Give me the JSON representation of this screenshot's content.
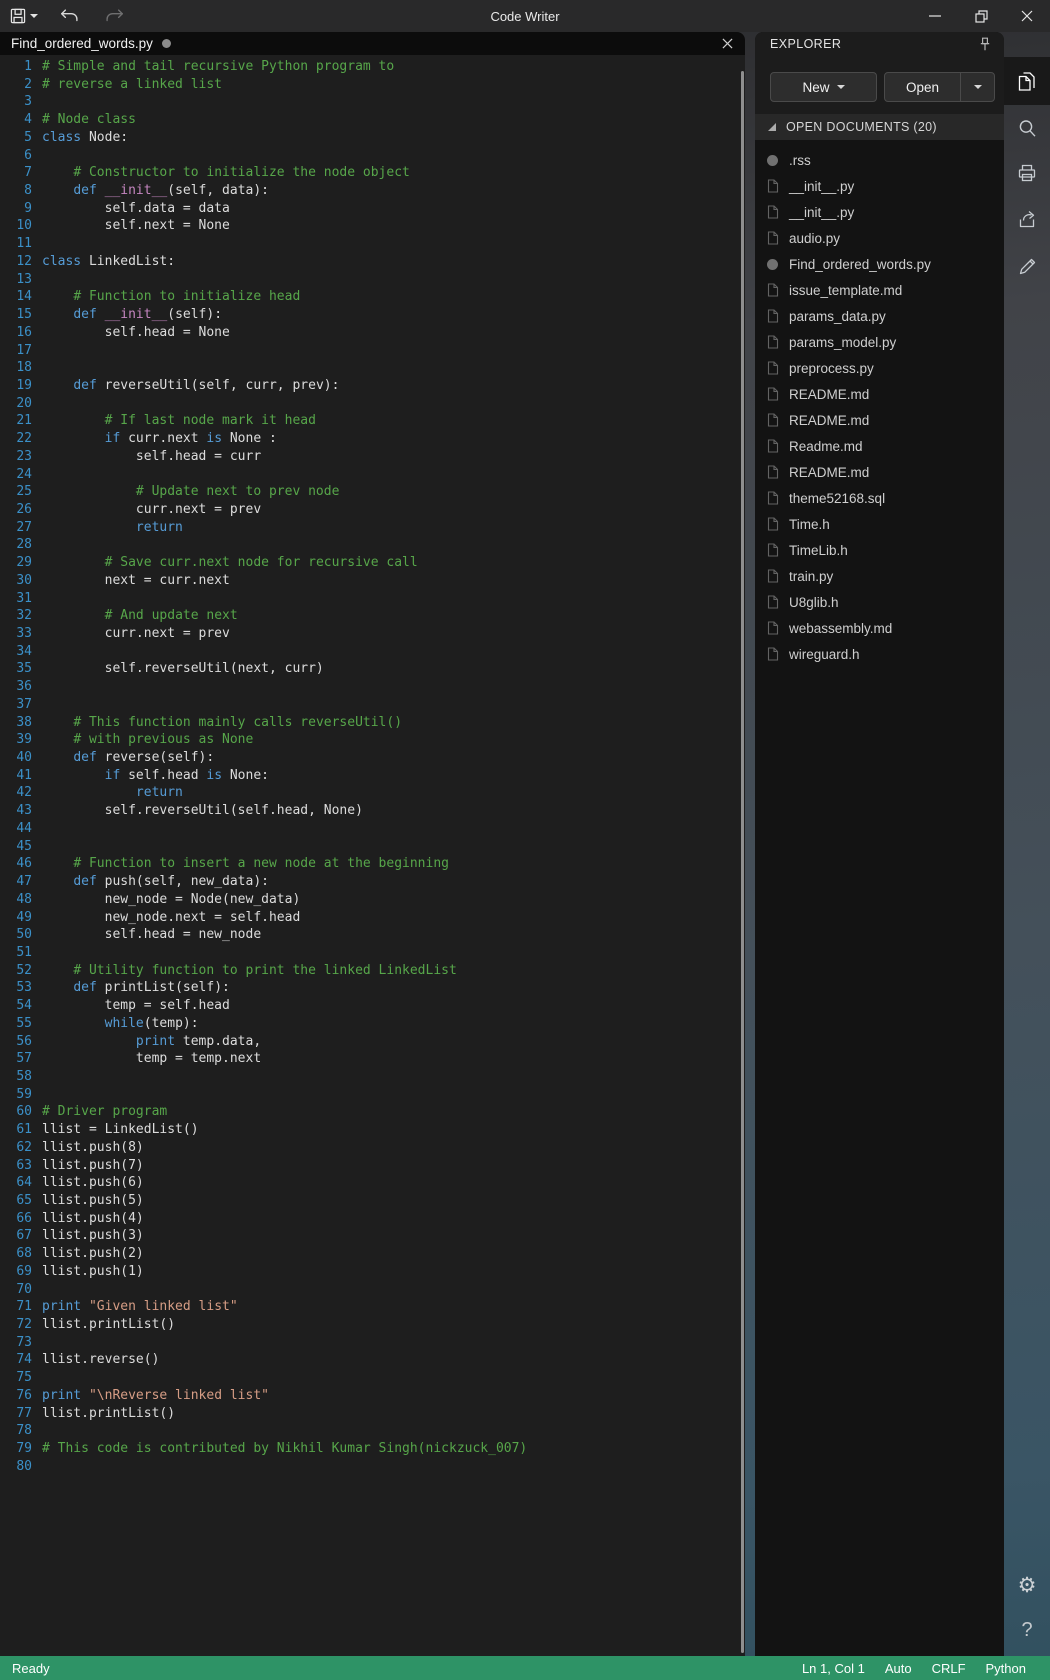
{
  "titlebar": {
    "title": "Code Writer"
  },
  "tab": {
    "label": "Find_ordered_words.py"
  },
  "explorer": {
    "title": "EXPLORER",
    "new_button": "New",
    "open_button": "Open",
    "section": "OPEN DOCUMENTS (20)",
    "files": [
      {
        "name": ".rss",
        "modified": true
      },
      {
        "name": "__init__.py",
        "modified": false
      },
      {
        "name": "__init__.py",
        "modified": false
      },
      {
        "name": "audio.py",
        "modified": false
      },
      {
        "name": "Find_ordered_words.py",
        "modified": true
      },
      {
        "name": "issue_template.md",
        "modified": false
      },
      {
        "name": "params_data.py",
        "modified": false
      },
      {
        "name": "params_model.py",
        "modified": false
      },
      {
        "name": "preprocess.py",
        "modified": false
      },
      {
        "name": "README.md",
        "modified": false
      },
      {
        "name": "README.md",
        "modified": false
      },
      {
        "name": "Readme.md",
        "modified": false
      },
      {
        "name": "README.md",
        "modified": false
      },
      {
        "name": "theme52168.sql",
        "modified": false
      },
      {
        "name": "Time.h",
        "modified": false
      },
      {
        "name": "TimeLib.h",
        "modified": false
      },
      {
        "name": "train.py",
        "modified": false
      },
      {
        "name": "U8glib.h",
        "modified": false
      },
      {
        "name": "webassembly.md",
        "modified": false
      },
      {
        "name": "wireguard.h",
        "modified": false
      }
    ]
  },
  "statusbar": {
    "ready": "Ready",
    "position": "Ln 1, Col 1",
    "encoding": "Auto",
    "eol": "CRLF",
    "language": "Python"
  },
  "colors": {
    "keyword": "#569CD6",
    "comment": "#57A64A",
    "string": "#D69D85",
    "special": "#C586C0",
    "text": "#DCDCDC",
    "line_number": "#3B90C8",
    "status_bar": "#2E9366"
  },
  "code": {
    "language": "Python",
    "lines": [
      [
        [
          "c",
          "# Simple and tail recursive Python program to"
        ]
      ],
      [
        [
          "c",
          "# reverse a linked list"
        ]
      ],
      [],
      [
        [
          "c",
          "# Node class"
        ]
      ],
      [
        [
          "k",
          "class"
        ],
        [
          "t",
          " Node:"
        ]
      ],
      [],
      [
        [
          "t",
          "    "
        ],
        [
          "c",
          "# Constructor to initialize the node object"
        ]
      ],
      [
        [
          "t",
          "    "
        ],
        [
          "k",
          "def"
        ],
        [
          "t",
          " "
        ],
        [
          "m",
          "__init__"
        ],
        [
          "t",
          "(self, data):"
        ]
      ],
      [
        [
          "t",
          "        self.data = data"
        ]
      ],
      [
        [
          "t",
          "        self.next = None"
        ]
      ],
      [],
      [
        [
          "k",
          "class"
        ],
        [
          "t",
          " LinkedList:"
        ]
      ],
      [],
      [
        [
          "t",
          "    "
        ],
        [
          "c",
          "# Function to initialize head"
        ]
      ],
      [
        [
          "t",
          "    "
        ],
        [
          "k",
          "def"
        ],
        [
          "t",
          " "
        ],
        [
          "m",
          "__init__"
        ],
        [
          "t",
          "(self):"
        ]
      ],
      [
        [
          "t",
          "        self.head = None"
        ]
      ],
      [],
      [],
      [
        [
          "t",
          "    "
        ],
        [
          "k",
          "def"
        ],
        [
          "t",
          " reverseUtil(self, curr, prev):"
        ]
      ],
      [],
      [
        [
          "t",
          "        "
        ],
        [
          "c",
          "# If last node mark it head"
        ]
      ],
      [
        [
          "t",
          "        "
        ],
        [
          "k",
          "if"
        ],
        [
          "t",
          " curr.next "
        ],
        [
          "k",
          "is"
        ],
        [
          "t",
          " None :"
        ]
      ],
      [
        [
          "t",
          "            self.head = curr"
        ]
      ],
      [],
      [
        [
          "t",
          "            "
        ],
        [
          "c",
          "# Update next to prev node"
        ]
      ],
      [
        [
          "t",
          "            curr.next = prev"
        ]
      ],
      [
        [
          "t",
          "            "
        ],
        [
          "k",
          "return"
        ]
      ],
      [],
      [
        [
          "t",
          "        "
        ],
        [
          "c",
          "# Save curr.next node for recursive call"
        ]
      ],
      [
        [
          "t",
          "        next = curr.next"
        ]
      ],
      [],
      [
        [
          "t",
          "        "
        ],
        [
          "c",
          "# And update next"
        ]
      ],
      [
        [
          "t",
          "        curr.next = prev"
        ]
      ],
      [],
      [
        [
          "t",
          "        self.reverseUtil(next, curr)"
        ]
      ],
      [],
      [],
      [
        [
          "t",
          "    "
        ],
        [
          "c",
          "# This function mainly calls reverseUtil()"
        ]
      ],
      [
        [
          "t",
          "    "
        ],
        [
          "c",
          "# with previous as None"
        ]
      ],
      [
        [
          "t",
          "    "
        ],
        [
          "k",
          "def"
        ],
        [
          "t",
          " reverse(self):"
        ]
      ],
      [
        [
          "t",
          "        "
        ],
        [
          "k",
          "if"
        ],
        [
          "t",
          " self.head "
        ],
        [
          "k",
          "is"
        ],
        [
          "t",
          " None:"
        ]
      ],
      [
        [
          "t",
          "            "
        ],
        [
          "k",
          "return"
        ]
      ],
      [
        [
          "t",
          "        self.reverseUtil(self.head, None)"
        ]
      ],
      [],
      [],
      [
        [
          "t",
          "    "
        ],
        [
          "c",
          "# Function to insert a new node at the beginning"
        ]
      ],
      [
        [
          "t",
          "    "
        ],
        [
          "k",
          "def"
        ],
        [
          "t",
          " push(self, new_data):"
        ]
      ],
      [
        [
          "t",
          "        new_node = Node(new_data)"
        ]
      ],
      [
        [
          "t",
          "        new_node.next = self.head"
        ]
      ],
      [
        [
          "t",
          "        self.head = new_node"
        ]
      ],
      [],
      [
        [
          "t",
          "    "
        ],
        [
          "c",
          "# Utility function to print the linked LinkedList"
        ]
      ],
      [
        [
          "t",
          "    "
        ],
        [
          "k",
          "def"
        ],
        [
          "t",
          " printList(self):"
        ]
      ],
      [
        [
          "t",
          "        temp = self.head"
        ]
      ],
      [
        [
          "t",
          "        "
        ],
        [
          "k",
          "while"
        ],
        [
          "t",
          "(temp):"
        ]
      ],
      [
        [
          "t",
          "            "
        ],
        [
          "k",
          "print"
        ],
        [
          "t",
          " temp.data,"
        ]
      ],
      [
        [
          "t",
          "            temp = temp.next"
        ]
      ],
      [],
      [],
      [
        [
          "c",
          "# Driver program"
        ]
      ],
      [
        [
          "t",
          "llist = LinkedList()"
        ]
      ],
      [
        [
          "t",
          "llist.push(8)"
        ]
      ],
      [
        [
          "t",
          "llist.push(7)"
        ]
      ],
      [
        [
          "t",
          "llist.push(6)"
        ]
      ],
      [
        [
          "t",
          "llist.push(5)"
        ]
      ],
      [
        [
          "t",
          "llist.push(4)"
        ]
      ],
      [
        [
          "t",
          "llist.push(3)"
        ]
      ],
      [
        [
          "t",
          "llist.push(2)"
        ]
      ],
      [
        [
          "t",
          "llist.push(1)"
        ]
      ],
      [],
      [
        [
          "k",
          "print"
        ],
        [
          "t",
          " "
        ],
        [
          "s",
          "\"Given linked list\""
        ]
      ],
      [
        [
          "t",
          "llist.printList()"
        ]
      ],
      [],
      [
        [
          "t",
          "llist.reverse()"
        ]
      ],
      [],
      [
        [
          "k",
          "print"
        ],
        [
          "t",
          " "
        ],
        [
          "s",
          "\"\\nReverse linked list\""
        ]
      ],
      [
        [
          "t",
          "llist.printList()"
        ]
      ],
      [],
      [
        [
          "c",
          "# This code is contributed by Nikhil Kumar Singh(nickzuck_007)"
        ]
      ],
      []
    ]
  }
}
